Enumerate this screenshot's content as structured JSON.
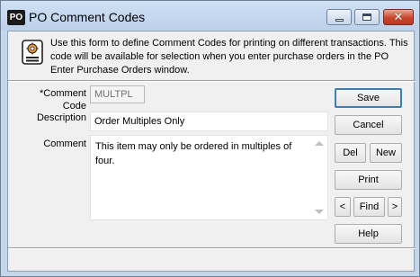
{
  "window": {
    "app_badge": "PO",
    "title": "PO Comment Codes",
    "controls": {
      "minimize_icon": "minimize-icon",
      "maximize_icon": "maximize-icon",
      "close_icon": "close-icon",
      "close_color": "#c8452c"
    }
  },
  "info": {
    "icon": "document-gear-icon",
    "text": "Use this form to define Comment Codes for printing on different transactions. This code will be available for selection when you enter purchase orders in the PO Enter Purchase Orders window."
  },
  "form": {
    "comment_code": {
      "label": "*Comment Code",
      "value": "MULTPL"
    },
    "description": {
      "label": "Description",
      "value": "Order Multiples Only"
    },
    "comment": {
      "label": "Comment",
      "value": "This item may only be ordered in multiples of four."
    }
  },
  "buttons": {
    "save": "Save",
    "cancel": "Cancel",
    "del": "Del",
    "new": "New",
    "print": "Print",
    "prev": "<",
    "find": "Find",
    "next": ">",
    "help": "Help"
  }
}
